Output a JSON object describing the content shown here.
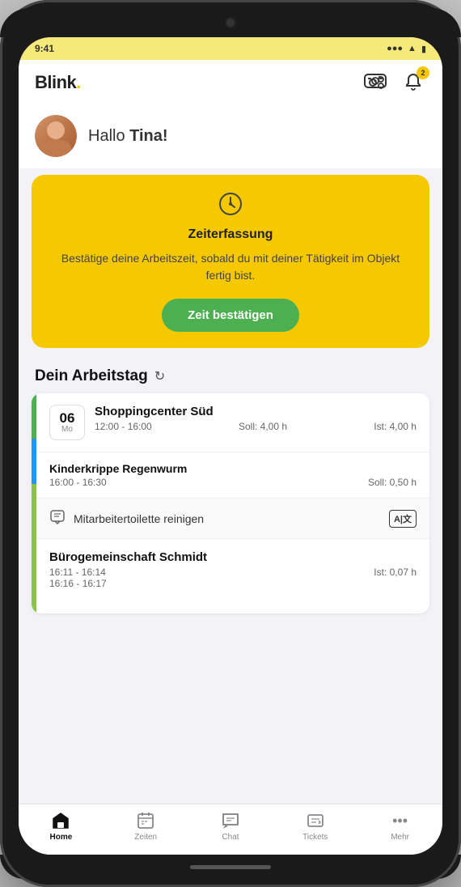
{
  "header": {
    "logo": "Blink",
    "logo_dot": ".",
    "settings_icon": "⚙",
    "notification_icon": "🔔",
    "notification_badge": "2"
  },
  "greeting": {
    "text_prefix": "Hallo ",
    "user_name": "Tina!"
  },
  "zeiterfassung_card": {
    "icon": "🕐",
    "title": "Zeiterfassung",
    "description": "Bestätige deine Arbeitszeit, sobald du mit deiner Tätigkeit im Objekt fertig bist.",
    "button_label": "Zeit bestätigen"
  },
  "workday_section": {
    "title": "Dein Arbeitstag",
    "refresh_icon": "↻",
    "entries": [
      {
        "id": "entry1",
        "date_day": "06",
        "date_weekday": "Mo",
        "name": "Shoppingcenter Süd",
        "time": "12:00 - 16:00",
        "soll": "Soll: 4,00 h",
        "ist": "Ist: 4,00 h"
      }
    ],
    "sub_entries": [
      {
        "id": "sub1",
        "name": "Kinderkrippe Regenwurm",
        "time": "16:00 - 16:30",
        "soll": "Soll: 0,50 h",
        "ist": ""
      }
    ],
    "task": {
      "icon": "💬",
      "name": "Mitarbeitertoilette reinigen",
      "badge": "A|文"
    },
    "extra_entries": [
      {
        "id": "extra1",
        "name": "Bürogemeinschaft Schmidt",
        "time1": "16:11 - 16:14",
        "time2": "16:16 - 16:17",
        "ist": "Ist: 0,07 h"
      }
    ]
  },
  "bottom_nav": {
    "items": [
      {
        "id": "home",
        "label": "Home",
        "active": true
      },
      {
        "id": "zeiten",
        "label": "Zeiten",
        "active": false
      },
      {
        "id": "chat",
        "label": "Chat",
        "active": false
      },
      {
        "id": "tickets",
        "label": "Tickets",
        "active": false
      },
      {
        "id": "mehr",
        "label": "Mehr",
        "active": false
      }
    ]
  }
}
